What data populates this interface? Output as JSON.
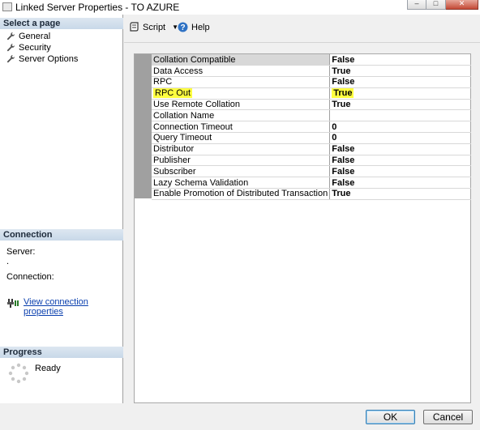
{
  "window": {
    "title": "Linked Server Properties - TO AZURE",
    "minimize": "–",
    "maximize": "□",
    "close": "✕"
  },
  "sidebar": {
    "select_page_header": "Select a page",
    "items": [
      {
        "label": "General",
        "icon": "wrench-icon"
      },
      {
        "label": "Security",
        "icon": "wrench-icon"
      },
      {
        "label": "Server Options",
        "icon": "wrench-icon"
      }
    ],
    "connection_header": "Connection",
    "server_label": "Server:",
    "server_value": ".",
    "connection_label": "Connection:",
    "view_link": "View connection properties",
    "progress_header": "Progress",
    "progress_status": "Ready"
  },
  "toolbar": {
    "script_label": "Script",
    "help_label": "Help"
  },
  "properties": [
    {
      "name": "Collation Compatible",
      "value": "False"
    },
    {
      "name": "Data Access",
      "value": "True"
    },
    {
      "name": "RPC",
      "value": "False"
    },
    {
      "name": "RPC Out",
      "value": "True"
    },
    {
      "name": "Use Remote Collation",
      "value": "True"
    },
    {
      "name": "Collation Name",
      "value": ""
    },
    {
      "name": "Connection Timeout",
      "value": "0"
    },
    {
      "name": "Query Timeout",
      "value": "0"
    },
    {
      "name": "Distributor",
      "value": "False"
    },
    {
      "name": "Publisher",
      "value": "False"
    },
    {
      "name": "Subscriber",
      "value": "False"
    },
    {
      "name": "Lazy Schema Validation",
      "value": "False"
    },
    {
      "name": "Enable Promotion of Distributed Transaction",
      "value": "True"
    }
  ],
  "footer": {
    "ok_label": "OK",
    "cancel_label": "Cancel"
  },
  "colors": {
    "highlight": "#ffff40",
    "link": "#0a3fae",
    "section_header": "#c8d8e8"
  }
}
